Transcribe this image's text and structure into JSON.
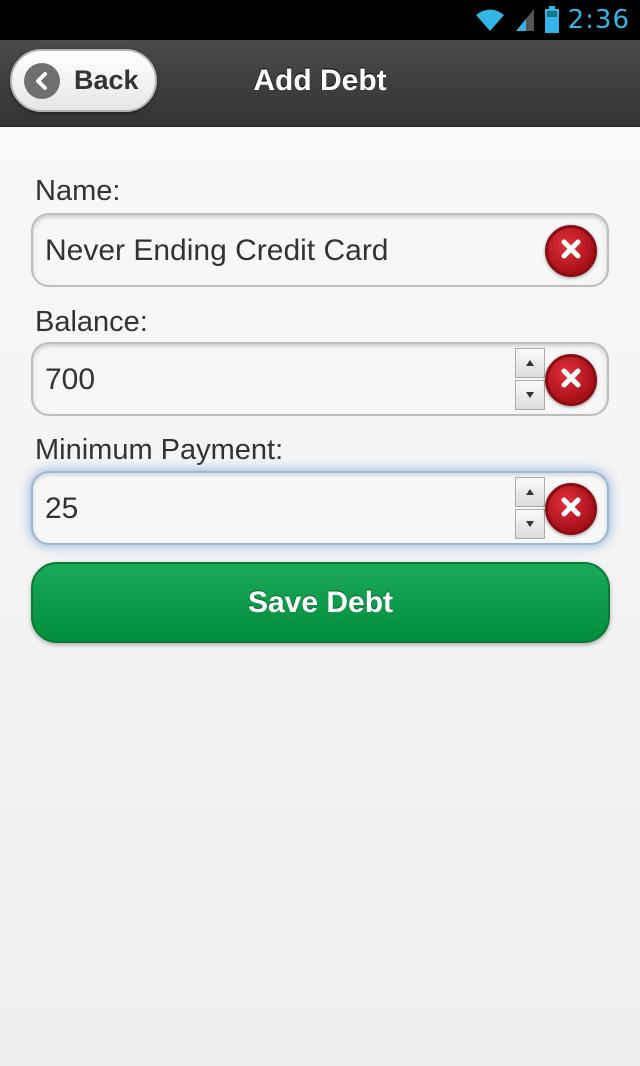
{
  "status_bar": {
    "time": "2:36",
    "icons": [
      "wifi-icon",
      "cell-signal-icon",
      "battery-icon"
    ],
    "color": "#33b5e5"
  },
  "header": {
    "back_label": "Back",
    "title": "Add Debt"
  },
  "form": {
    "name": {
      "label": "Name:",
      "value": "Never Ending Credit Card"
    },
    "balance": {
      "label": "Balance:",
      "value": "700"
    },
    "minimum_payment": {
      "label": "Minimum Payment:",
      "value": "25",
      "focused": true
    },
    "save_label": "Save Debt"
  },
  "colors": {
    "save_button": "#009a47",
    "header": "#3d3d3d",
    "clear_button": "#b81620"
  }
}
